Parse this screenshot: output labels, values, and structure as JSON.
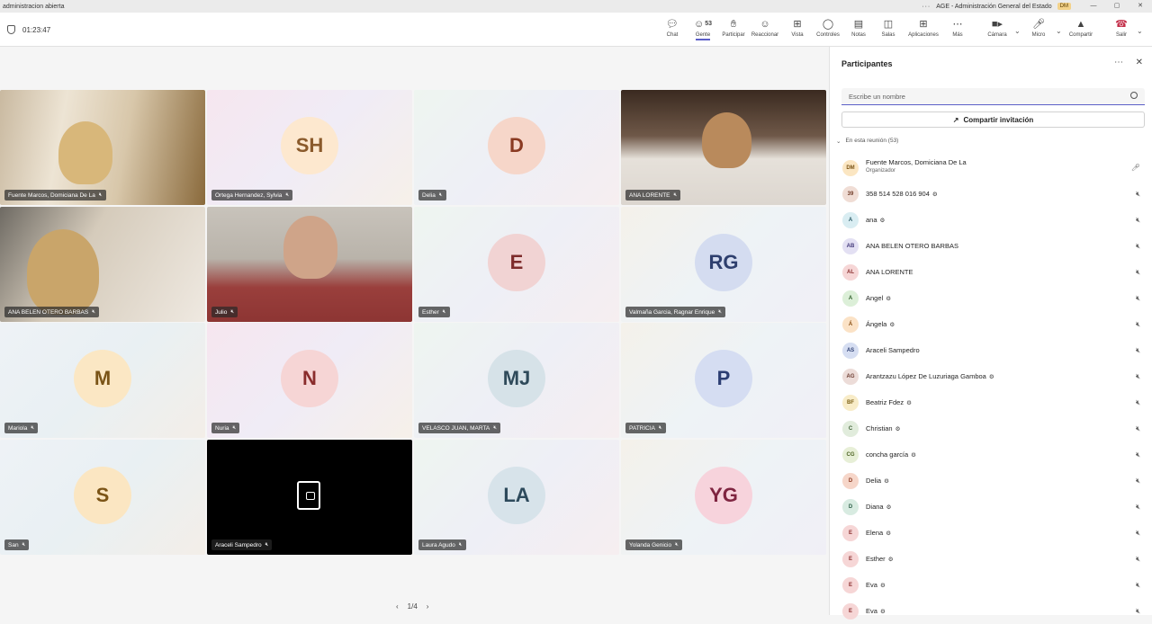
{
  "window": {
    "left_title": "administracion abierta",
    "right_title": "AGE - Administración General del Estado",
    "user_badge": "DM",
    "controls": [
      "—",
      "▢",
      "✕"
    ]
  },
  "meeting": {
    "timer": "01:23:47"
  },
  "toolbar": {
    "chat": "Chat",
    "people": "Gente",
    "people_count": "53",
    "raise": "Participar",
    "react": "Reaccionar",
    "view": "Vista",
    "controls": "Controles",
    "notes": "Notas",
    "rooms": "Salas",
    "apps": "Aplicaciones",
    "more": "Más",
    "camera": "Cámara",
    "mic": "Micro",
    "share": "Compartir",
    "leave": "Salir"
  },
  "tiles": [
    {
      "name": "Fuente Marcos, Domiciana De La",
      "kind": "video"
    },
    {
      "name": "Ortega Hernandez, Sylvia",
      "initials": "SH",
      "bg": "#fde8cf",
      "fg": "#8a5a2b"
    },
    {
      "name": "Delia",
      "initials": "D",
      "bg": "#f6d6c9",
      "fg": "#8a3a22"
    },
    {
      "name": "ANA LORENTE",
      "kind": "video"
    },
    {
      "name": "ANA BELEN OTERO BARBAS",
      "kind": "video"
    },
    {
      "name": "Julio",
      "kind": "video"
    },
    {
      "name": "Esther",
      "initials": "E",
      "bg": "#f1d3d3",
      "fg": "#7d2b2b"
    },
    {
      "name": "Valmaña Garcia, Ragnar Enrique",
      "initials": "RG",
      "bg": "#d4dcf0",
      "fg": "#2e3f6e"
    },
    {
      "name": "Mariola",
      "initials": "M",
      "bg": "#fbe7c4",
      "fg": "#7a5417"
    },
    {
      "name": "Nuria",
      "initials": "N",
      "bg": "#f6d5d5",
      "fg": "#8a2d2d"
    },
    {
      "name": "VELASCO JUAN, MARTA",
      "initials": "MJ",
      "bg": "#d6e2e8",
      "fg": "#2f4a5a"
    },
    {
      "name": "PATRICIA",
      "initials": "P",
      "bg": "#d5ddf2",
      "fg": "#2c3e73"
    },
    {
      "name": "San",
      "initials": "S",
      "bg": "#fbe6c2",
      "fg": "#7b5416"
    },
    {
      "name": "Araceli Sampedro",
      "kind": "locked"
    },
    {
      "name": "Laura Agudo",
      "initials": "LA",
      "bg": "#d7e3ea",
      "fg": "#2d4a5c"
    },
    {
      "name": "Yolanda Genicio",
      "initials": "YG",
      "bg": "#f7d3dc",
      "fg": "#7f2541"
    }
  ],
  "pager": {
    "text": "1/4"
  },
  "panel": {
    "title": "Participantes",
    "search_placeholder": "Escribe un nombre",
    "invite_label": "Compartir invitación",
    "section_label": "En esta reunión (53)",
    "organizer_label": "Organizador",
    "participants": [
      {
        "initials": "DM",
        "name": "Fuente Marcos, Domiciana De La",
        "bg": "#fbe6c2",
        "fg": "#7b5416"
      },
      {
        "initials": "39",
        "name": "358 514 528 016 904",
        "bg": "#f0ddd5",
        "fg": "#6f3a26"
      },
      {
        "initials": "A",
        "name": "ana",
        "bg": "#d9edf2",
        "fg": "#2b5a66"
      },
      {
        "initials": "AB",
        "name": "ANA BELEN OTERO BARBAS",
        "bg": "#e3e0f3",
        "fg": "#43397a"
      },
      {
        "initials": "AL",
        "name": "ANA LORENTE",
        "bg": "#f6d6d6",
        "fg": "#8a2f2f"
      },
      {
        "initials": "A",
        "name": "Angel",
        "bg": "#dcefd8",
        "fg": "#2f5e2a"
      },
      {
        "initials": "Á",
        "name": "Ángela",
        "bg": "#fbe2c6",
        "fg": "#8a4f14"
      },
      {
        "initials": "AS",
        "name": "Araceli Sampedro",
        "bg": "#d6def2",
        "fg": "#2e3f73"
      },
      {
        "initials": "AG",
        "name": "Arantzazu López De Luzuriaga Gamboa",
        "bg": "#ecdcd8",
        "fg": "#6b3b30"
      },
      {
        "initials": "BF",
        "name": "Beatriz Fdez",
        "bg": "#f8ecc8",
        "fg": "#7a5e12"
      },
      {
        "initials": "C",
        "name": "Christian",
        "bg": "#e1ecdc",
        "fg": "#3b5e33"
      },
      {
        "initials": "CG",
        "name": "concha garcía",
        "bg": "#e7efd7",
        "fg": "#4c6322"
      },
      {
        "initials": "D",
        "name": "Delia",
        "bg": "#f6d6c9",
        "fg": "#8a3a22"
      },
      {
        "initials": "D",
        "name": "Diana",
        "bg": "#d8ebe1",
        "fg": "#2e6048"
      },
      {
        "initials": "E",
        "name": "Elena",
        "bg": "#f6d6d6",
        "fg": "#8a2f2f"
      },
      {
        "initials": "E",
        "name": "Esther",
        "bg": "#f6d6d6",
        "fg": "#8a2f2f"
      },
      {
        "initials": "E",
        "name": "Eva",
        "bg": "#f6d6d6",
        "fg": "#8a2f2f"
      },
      {
        "initials": "E",
        "name": "Eva",
        "bg": "#f6d6d6",
        "fg": "#8a2f2f"
      }
    ]
  }
}
